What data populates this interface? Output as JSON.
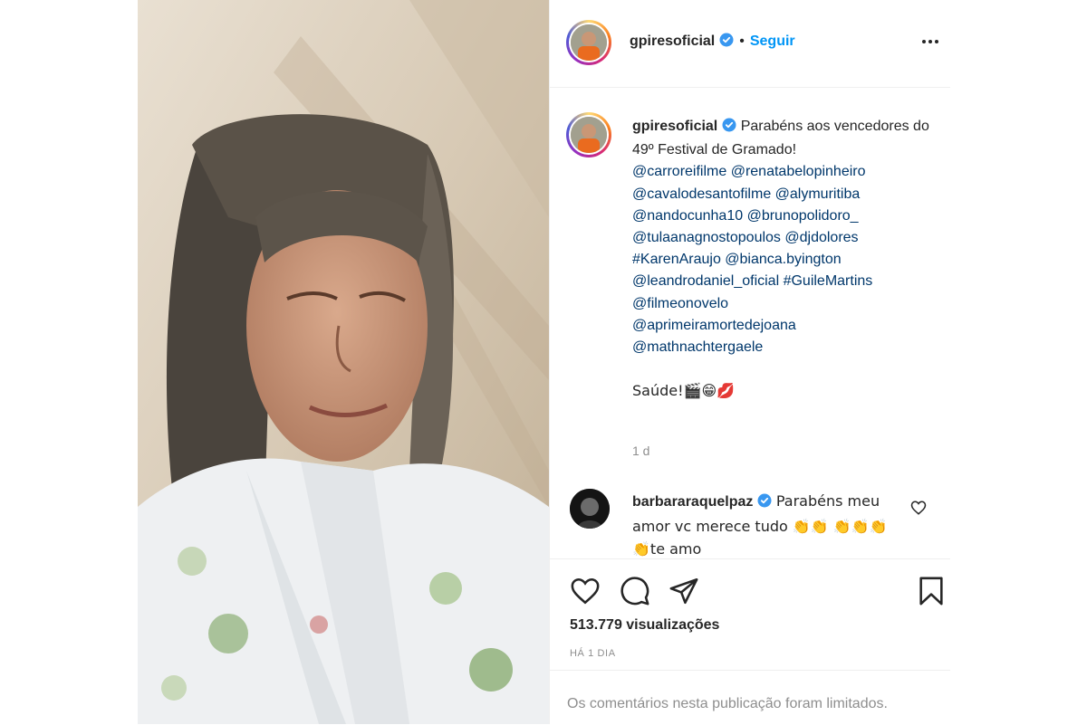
{
  "post": {
    "username": "gpiresoficial",
    "follow_label": "Seguir",
    "separator": "•",
    "caption": {
      "text": "Parabéns aos vencedores do 49º Festival de Gramado!",
      "mentions": [
        "@carroreifilme @renatabelopinheiro",
        "@cavalodesantofilme @alymuritiba",
        "@nandocunha10 @brunopolidoro_",
        "@tulaanagnostopoulos @djdolores",
        "#KarenAraujo @bianca.byington",
        "@leandrodaniel_oficial #GuileMartins",
        "@filmeonovelo",
        "@aprimeiramortedejoana",
        "@mathnachtergaele"
      ],
      "closing": "Saúde!🎬😁💋"
    },
    "caption_time": "1 d"
  },
  "comment": {
    "username": "barbararaquelpaz",
    "text": "Parabéns meu amor vc merece tudo 👏👏 👏👏👏👏te amo"
  },
  "stats": {
    "views": "513.779 visualizações",
    "posted_ago": "HÁ 1 DIA"
  },
  "footer": {
    "comments_limited": "Os comentários nesta publicação foram limitados."
  },
  "icons": {
    "verified": "verified-badge-icon",
    "more": "more-options-icon",
    "like": "heart-icon",
    "comment": "comment-icon",
    "share": "share-icon",
    "save": "bookmark-icon"
  },
  "colors": {
    "link": "#00376b",
    "follow": "#0095f6",
    "verified": "#3897f0",
    "muted": "#8e8e8e"
  }
}
